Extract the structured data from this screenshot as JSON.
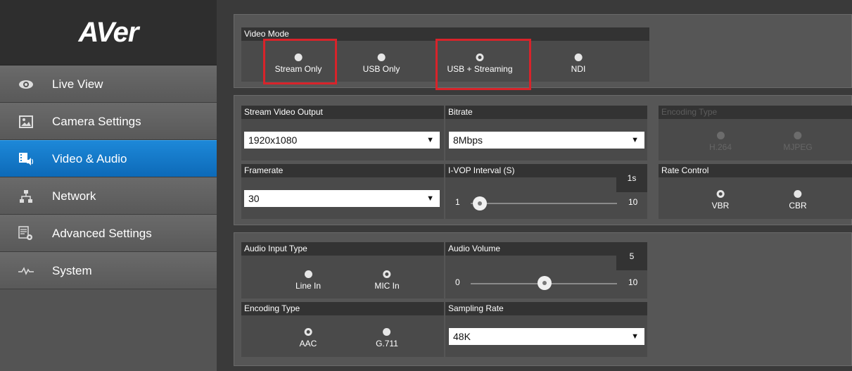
{
  "brand": {
    "logo": "AVer"
  },
  "sidebar": {
    "items": [
      {
        "label": "Live View",
        "icon": "eye-icon",
        "active": false
      },
      {
        "label": "Camera Settings",
        "icon": "image-icon",
        "active": false
      },
      {
        "label": "Video & Audio",
        "icon": "video-audio-icon",
        "active": true
      },
      {
        "label": "Network",
        "icon": "network-icon",
        "active": false
      },
      {
        "label": "Advanced Settings",
        "icon": "advanced-settings-icon",
        "active": false
      },
      {
        "label": "System",
        "icon": "pulse-icon",
        "active": false
      }
    ]
  },
  "video_mode": {
    "title": "Video Mode",
    "options": [
      {
        "label": "Stream Only",
        "selected": false,
        "highlighted": true
      },
      {
        "label": "USB Only",
        "selected": false,
        "highlighted": false
      },
      {
        "label": "USB + Streaming",
        "selected": true,
        "highlighted": true
      },
      {
        "label": "NDI",
        "selected": false,
        "highlighted": false
      }
    ]
  },
  "stream_video_output": {
    "title": "Stream Video Output",
    "value": "1920x1080"
  },
  "bitrate": {
    "title": "Bitrate",
    "value": "8Mbps"
  },
  "video_encoding_type": {
    "title": "Encoding Type",
    "disabled": true,
    "options": [
      {
        "label": "H.264",
        "selected": true
      },
      {
        "label": "MJPEG",
        "selected": false
      }
    ]
  },
  "framerate": {
    "title": "Framerate",
    "value": "30"
  },
  "ivop_interval": {
    "title": "I-VOP Interval (S)",
    "value_label": "1s",
    "min_label": "1",
    "max_label": "10",
    "min": 1,
    "max": 10,
    "value": 1
  },
  "rate_control": {
    "title": "Rate Control",
    "options": [
      {
        "label": "VBR",
        "selected": true
      },
      {
        "label": "CBR",
        "selected": false
      }
    ]
  },
  "audio_input_type": {
    "title": "Audio Input Type",
    "options": [
      {
        "label": "Line In",
        "selected": false
      },
      {
        "label": "MIC In",
        "selected": true
      }
    ]
  },
  "audio_volume": {
    "title": "Audio Volume",
    "value_label": "5",
    "min_label": "0",
    "max_label": "10",
    "min": 0,
    "max": 10,
    "value": 5
  },
  "audio_encoding_type": {
    "title": "Encoding Type",
    "options": [
      {
        "label": "AAC",
        "selected": true
      },
      {
        "label": "G.711",
        "selected": false
      }
    ]
  },
  "sampling_rate": {
    "title": "Sampling Rate",
    "value": "48K"
  },
  "colors": {
    "accent": "#0d6ab8",
    "highlight": "#d8232a"
  }
}
